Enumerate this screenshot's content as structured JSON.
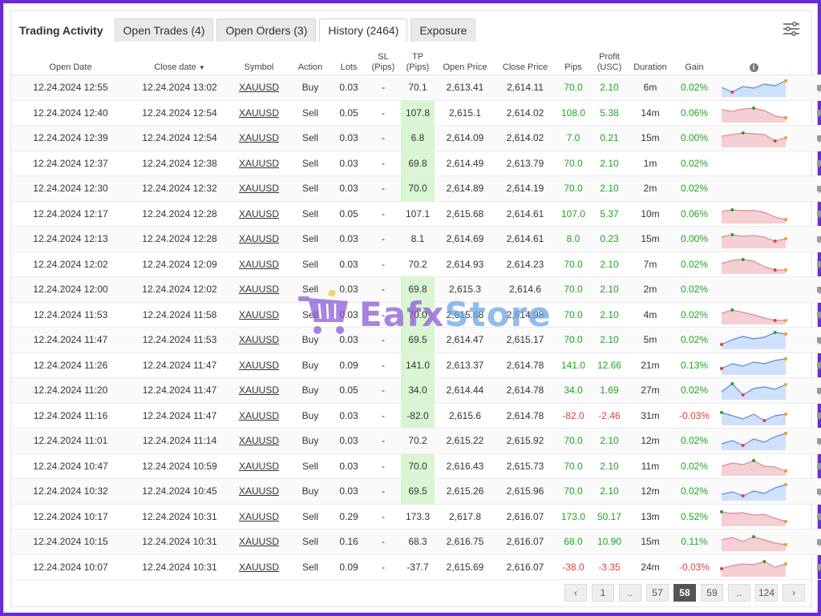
{
  "tabs": {
    "title": "Trading Activity",
    "items": [
      {
        "label": "Open Trades (4)",
        "active": false
      },
      {
        "label": "Open Orders (3)",
        "active": false
      },
      {
        "label": "History (2464)",
        "active": true
      },
      {
        "label": "Exposure",
        "active": false
      }
    ]
  },
  "columns": {
    "open_date": "Open Date",
    "close_date": "Close date",
    "sort_marker": "▼",
    "symbol": "Symbol",
    "action": "Action",
    "lots": "Lots",
    "sl_1": "SL",
    "sl_2": "(Pips)",
    "tp_1": "TP",
    "tp_2": "(Pips)",
    "open_price": "Open Price",
    "close_price": "Close Price",
    "pips": "Pips",
    "profit_1": "Profit",
    "profit_2": "(USC)",
    "duration": "Duration",
    "gain": "Gain",
    "info": "i"
  },
  "colors": {
    "positive": "#23a323",
    "negative": "#e0413a",
    "tp_highlight": "#d9f5d2",
    "spark_buy_fill": "#cfe0fb",
    "spark_buy_line": "#5b87e0",
    "spark_sell_fill": "#f4cfd3",
    "spark_sell_line": "#e08a95"
  },
  "rows": [
    {
      "open": "12.24.2024 12:55",
      "close": "12.24.2024 13:02",
      "symbol": "XAUUSD",
      "action": "Buy",
      "lots": "0.03",
      "sl": "-",
      "tp": "70.1",
      "open_price": "2,613.41",
      "close_price": "2,614.11",
      "pips": "70.0",
      "profit": "2.10",
      "duration": "6m",
      "gain": "0.02%",
      "sign": "pos",
      "tp_hl": false,
      "spark": [
        0.5,
        0.2,
        0.55,
        0.45,
        0.7,
        0.6,
        0.9
      ]
    },
    {
      "open": "12.24.2024 12:40",
      "close": "12.24.2024 12:54",
      "symbol": "XAUUSD",
      "action": "Sell",
      "lots": "0.05",
      "sl": "-",
      "tp": "107.8",
      "open_price": "2,615.1",
      "close_price": "2,614.02",
      "pips": "108.0",
      "profit": "5.38",
      "duration": "14m",
      "gain": "0.06%",
      "sign": "pos",
      "tp_hl": true,
      "spark": [
        0.7,
        0.6,
        0.75,
        0.8,
        0.65,
        0.3,
        0.2
      ]
    },
    {
      "open": "12.24.2024 12:39",
      "close": "12.24.2024 12:54",
      "symbol": "XAUUSD",
      "action": "Sell",
      "lots": "0.03",
      "sl": "-",
      "tp": "6.8",
      "open_price": "2,614.09",
      "close_price": "2,614.02",
      "pips": "7.0",
      "profit": "0.21",
      "duration": "15m",
      "gain": "0.00%",
      "sign": "pos",
      "tp_hl": true,
      "spark": [
        0.6,
        0.7,
        0.8,
        0.75,
        0.7,
        0.3,
        0.5
      ]
    },
    {
      "open": "12.24.2024 12:37",
      "close": "12.24.2024 12:38",
      "symbol": "XAUUSD",
      "action": "Sell",
      "lots": "0.03",
      "sl": "-",
      "tp": "69.8",
      "open_price": "2,614.49",
      "close_price": "2,613.79",
      "pips": "70.0",
      "profit": "2.10",
      "duration": "1m",
      "gain": "0.02%",
      "sign": "pos",
      "tp_hl": true,
      "spark": []
    },
    {
      "open": "12.24.2024 12:30",
      "close": "12.24.2024 12:32",
      "symbol": "XAUUSD",
      "action": "Sell",
      "lots": "0.03",
      "sl": "-",
      "tp": "70.0",
      "open_price": "2,614.89",
      "close_price": "2,614.19",
      "pips": "70.0",
      "profit": "2.10",
      "duration": "2m",
      "gain": "0.02%",
      "sign": "pos",
      "tp_hl": true,
      "spark": []
    },
    {
      "open": "12.24.2024 12:17",
      "close": "12.24.2024 12:28",
      "symbol": "XAUUSD",
      "action": "Sell",
      "lots": "0.05",
      "sl": "-",
      "tp": "107.1",
      "open_price": "2,615.68",
      "close_price": "2,614.61",
      "pips": "107.0",
      "profit": "5.37",
      "duration": "10m",
      "gain": "0.06%",
      "sign": "pos",
      "tp_hl": false,
      "spark": [
        0.65,
        0.75,
        0.7,
        0.72,
        0.6,
        0.3,
        0.15
      ]
    },
    {
      "open": "12.24.2024 12:13",
      "close": "12.24.2024 12:28",
      "symbol": "XAUUSD",
      "action": "Sell",
      "lots": "0.03",
      "sl": "-",
      "tp": "8.1",
      "open_price": "2,614.69",
      "close_price": "2,614.61",
      "pips": "8.0",
      "profit": "0.23",
      "duration": "15m",
      "gain": "0.00%",
      "sign": "pos",
      "tp_hl": false,
      "spark": [
        0.6,
        0.75,
        0.65,
        0.7,
        0.6,
        0.35,
        0.5
      ]
    },
    {
      "open": "12.24.2024 12:02",
      "close": "12.24.2024 12:09",
      "symbol": "XAUUSD",
      "action": "Sell",
      "lots": "0.03",
      "sl": "-",
      "tp": "70.2",
      "open_price": "2,614.93",
      "close_price": "2,614.23",
      "pips": "70.0",
      "profit": "2.10",
      "duration": "7m",
      "gain": "0.02%",
      "sign": "pos",
      "tp_hl": false,
      "spark": [
        0.55,
        0.75,
        0.8,
        0.7,
        0.35,
        0.15,
        0.15
      ]
    },
    {
      "open": "12.24.2024 12:00",
      "close": "12.24.2024 12:02",
      "symbol": "XAUUSD",
      "action": "Sell",
      "lots": "0.03",
      "sl": "-",
      "tp": "69.8",
      "open_price": "2,615.3",
      "close_price": "2,614.6",
      "pips": "70.0",
      "profit": "2.10",
      "duration": "2m",
      "gain": "0.02%",
      "sign": "pos",
      "tp_hl": true,
      "spark": []
    },
    {
      "open": "12.24.2024 11:53",
      "close": "12.24.2024 11:58",
      "symbol": "XAUUSD",
      "action": "Sell",
      "lots": "0.03",
      "sl": "-",
      "tp": "70.0",
      "open_price": "2,615.68",
      "close_price": "2,614.98",
      "pips": "70.0",
      "profit": "2.10",
      "duration": "4m",
      "gain": "0.02%",
      "sign": "pos",
      "tp_hl": true,
      "spark": [
        0.6,
        0.8,
        0.65,
        0.5,
        0.3,
        0.15,
        0.15
      ]
    },
    {
      "open": "12.24.2024 11:47",
      "close": "12.24.2024 11:53",
      "symbol": "XAUUSD",
      "action": "Buy",
      "lots": "0.03",
      "sl": "-",
      "tp": "69.5",
      "open_price": "2,614.47",
      "close_price": "2,615.17",
      "pips": "70.0",
      "profit": "2.10",
      "duration": "5m",
      "gain": "0.02%",
      "sign": "pos",
      "tp_hl": true,
      "spark": [
        0.2,
        0.5,
        0.7,
        0.55,
        0.65,
        0.95,
        0.85
      ]
    },
    {
      "open": "12.24.2024 11:26",
      "close": "12.24.2024 11:47",
      "symbol": "XAUUSD",
      "action": "Buy",
      "lots": "0.09",
      "sl": "-",
      "tp": "141.0",
      "open_price": "2,613.37",
      "close_price": "2,614.78",
      "pips": "141.0",
      "profit": "12.66",
      "duration": "21m",
      "gain": "0.13%",
      "sign": "pos",
      "tp_hl": true,
      "spark": [
        0.3,
        0.6,
        0.45,
        0.7,
        0.6,
        0.8,
        0.9
      ]
    },
    {
      "open": "12.24.2024 11:20",
      "close": "12.24.2024 11:47",
      "symbol": "XAUUSD",
      "action": "Buy",
      "lots": "0.05",
      "sl": "-",
      "tp": "34.0",
      "open_price": "2,614.44",
      "close_price": "2,614.78",
      "pips": "34.0",
      "profit": "1.69",
      "duration": "27m",
      "gain": "0.02%",
      "sign": "pos",
      "tp_hl": true,
      "spark": [
        0.4,
        0.9,
        0.2,
        0.6,
        0.7,
        0.55,
        0.85
      ]
    },
    {
      "open": "12.24.2024 11:16",
      "close": "12.24.2024 11:47",
      "symbol": "XAUUSD",
      "action": "Buy",
      "lots": "0.03",
      "sl": "-",
      "tp": "-82.0",
      "open_price": "2,615.6",
      "close_price": "2,614.78",
      "pips": "-82.0",
      "profit": "-2.46",
      "duration": "31m",
      "gain": "-0.03%",
      "sign": "neg",
      "tp_hl": true,
      "spark": [
        0.7,
        0.5,
        0.3,
        0.6,
        0.2,
        0.5,
        0.6
      ]
    },
    {
      "open": "12.24.2024 11:01",
      "close": "12.24.2024 11:14",
      "symbol": "XAUUSD",
      "action": "Buy",
      "lots": "0.03",
      "sl": "-",
      "tp": "70.2",
      "open_price": "2,615.22",
      "close_price": "2,615.92",
      "pips": "70.0",
      "profit": "2.10",
      "duration": "12m",
      "gain": "0.02%",
      "sign": "pos",
      "tp_hl": false,
      "spark": [
        0.3,
        0.5,
        0.2,
        0.6,
        0.4,
        0.75,
        0.95
      ]
    },
    {
      "open": "12.24.2024 10:47",
      "close": "12.24.2024 10:59",
      "symbol": "XAUUSD",
      "action": "Sell",
      "lots": "0.03",
      "sl": "-",
      "tp": "70.0",
      "open_price": "2,616.43",
      "close_price": "2,615.73",
      "pips": "70.0",
      "profit": "2.10",
      "duration": "11m",
      "gain": "0.02%",
      "sign": "pos",
      "tp_hl": true,
      "spark": [
        0.5,
        0.7,
        0.6,
        0.85,
        0.5,
        0.45,
        0.2
      ]
    },
    {
      "open": "12.24.2024 10:32",
      "close": "12.24.2024 10:45",
      "symbol": "XAUUSD",
      "action": "Buy",
      "lots": "0.03",
      "sl": "-",
      "tp": "69.5",
      "open_price": "2,615.26",
      "close_price": "2,615.96",
      "pips": "70.0",
      "profit": "2.10",
      "duration": "12m",
      "gain": "0.02%",
      "sign": "pos",
      "tp_hl": true,
      "spark": [
        0.3,
        0.45,
        0.2,
        0.5,
        0.35,
        0.7,
        0.9
      ]
    },
    {
      "open": "12.24.2024 10:17",
      "close": "12.24.2024 10:31",
      "symbol": "XAUUSD",
      "action": "Sell",
      "lots": "0.29",
      "sl": "-",
      "tp": "173.3",
      "open_price": "2,617.8",
      "close_price": "2,616.07",
      "pips": "173.0",
      "profit": "50.17",
      "duration": "13m",
      "gain": "0.52%",
      "sign": "pos",
      "tp_hl": false,
      "spark": [
        0.8,
        0.7,
        0.75,
        0.6,
        0.65,
        0.4,
        0.2
      ]
    },
    {
      "open": "12.24.2024 10:15",
      "close": "12.24.2024 10:31",
      "symbol": "XAUUSD",
      "action": "Sell",
      "lots": "0.16",
      "sl": "-",
      "tp": "68.3",
      "open_price": "2,616.75",
      "close_price": "2,616.07",
      "pips": "68.0",
      "profit": "10.90",
      "duration": "15m",
      "gain": "0.11%",
      "sign": "pos",
      "tp_hl": false,
      "spark": [
        0.6,
        0.75,
        0.5,
        0.8,
        0.6,
        0.4,
        0.3
      ]
    },
    {
      "open": "12.24.2024 10:07",
      "close": "12.24.2024 10:31",
      "symbol": "XAUUSD",
      "action": "Sell",
      "lots": "0.09",
      "sl": "-",
      "tp": "-37.7",
      "open_price": "2,615.69",
      "close_price": "2,616.07",
      "pips": "-38.0",
      "profit": "-3.35",
      "duration": "24m",
      "gain": "-0.03%",
      "sign": "neg",
      "tp_hl": false,
      "spark": [
        0.4,
        0.6,
        0.7,
        0.65,
        0.85,
        0.5,
        0.7
      ]
    }
  ],
  "pagination": {
    "prev": "‹",
    "next": "›",
    "pages": [
      {
        "label": "1",
        "active": false
      },
      {
        "label": "..",
        "active": false,
        "dots": true
      },
      {
        "label": "57",
        "active": false
      },
      {
        "label": "58",
        "active": true
      },
      {
        "label": "59",
        "active": false
      },
      {
        "label": "..",
        "active": false,
        "dots": true
      },
      {
        "label": "124",
        "active": false
      }
    ]
  },
  "watermark": {
    "brand": "Eafx",
    "suffix": "Store"
  }
}
